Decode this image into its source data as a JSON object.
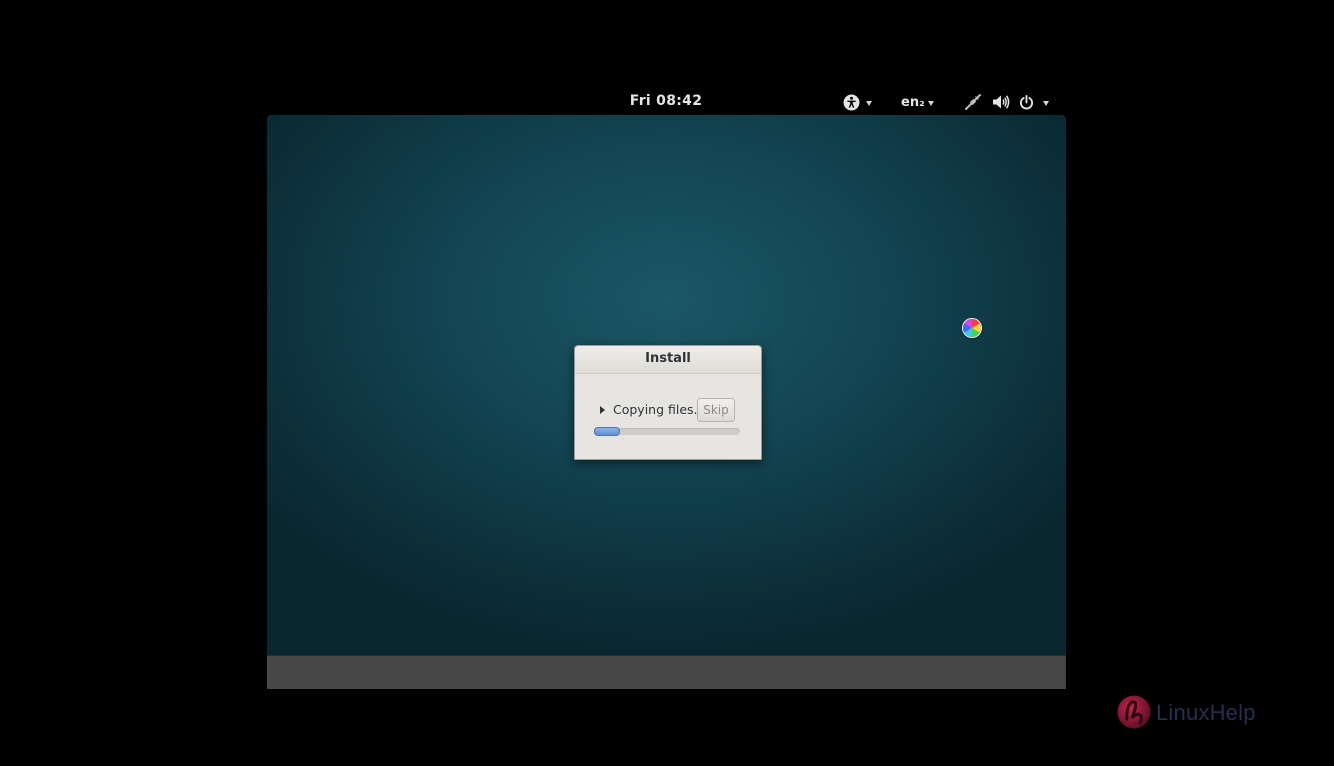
{
  "top_panel": {
    "clock": "Fri 08:42",
    "accessibility_icon": "accessibility-icon",
    "language": "en₂",
    "network_icon": "wired-network-disconnected-icon",
    "volume_icon": "volume-icon",
    "power_icon": "power-icon"
  },
  "dialog": {
    "title": "Install",
    "status": "Copying files...",
    "skip_label": "Skip",
    "progress": 0.18
  },
  "cursor": {
    "icon": "busy-spinner-icon"
  },
  "watermark": {
    "logo_icon": "linuxhelp-logo-icon",
    "text": "LinuxHelp"
  },
  "colors": {
    "desktop": "#134654",
    "dialog_bg": "#e6e5e2",
    "progress_fill": "#5c8fd3",
    "bottom_bar": "#474747"
  }
}
